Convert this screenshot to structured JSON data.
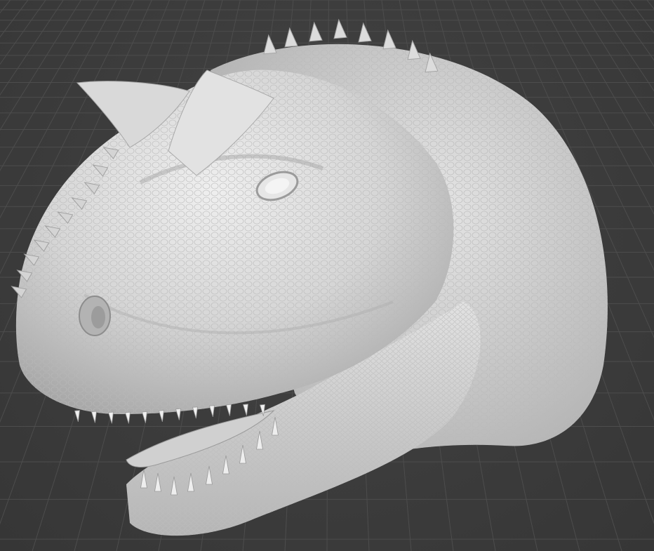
{
  "viewport": {
    "background_color": "#3d3d3d",
    "grid_color": "#4d4d4d",
    "grid_major_color": "#555555",
    "model_base_color": "#d9d9d9",
    "model_shadow_color": "#8f8f8f",
    "model_highlight_color": "#f2f2f2"
  },
  "model": {
    "subject": "dinosaur-head-sculpt",
    "features": [
      "horn",
      "eye",
      "nostril",
      "teeth",
      "scales",
      "back-spikes"
    ]
  }
}
